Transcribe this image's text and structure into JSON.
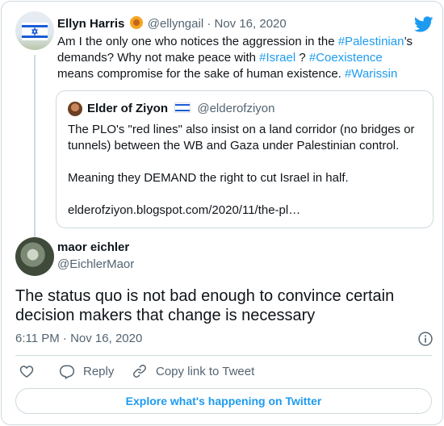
{
  "parent_tweet": {
    "name": "Ellyn Harris",
    "handle": "@ellyngail",
    "separator": "·",
    "date": "Nov 16, 2020",
    "text_parts": [
      "Am I the only one who notices the aggression in the ",
      "#Palestinian",
      "’s demands? Why not make peace with ",
      "#Israel",
      " ? ",
      "#Coexistence",
      " means compromise for the sake of human existence. ",
      "#Warissin"
    ]
  },
  "quoted_tweet": {
    "name": "Elder of Ziyon",
    "handle": "@elderofziyon",
    "paragraphs": [
      "The PLO's \"red lines\" also insist on a land corridor (no bridges or tunnels) between the WB and Gaza under Palestinian control.",
      "Meaning they DEMAND the right to cut Israel in half.",
      "elderofziyon.blogspot.com/2020/11/the-pl…"
    ]
  },
  "reply_tweet": {
    "name": "maor eichler",
    "handle": "@EichlerMaor",
    "text": "The status quo is not bad enough to convince certain decision makers that change is necessary",
    "time": "6:11 PM",
    "separator": "·",
    "date": "Nov 16, 2020"
  },
  "actions": {
    "reply_label": "Reply",
    "copy_link_label": "Copy link to Tweet"
  },
  "explore_label": "Explore what's happening on Twitter",
  "colors": {
    "accent": "#1d9bf0",
    "text": "#0f1419",
    "muted": "#536471",
    "border": "#cfd9de"
  },
  "icons": [
    "twitter-bird-icon",
    "info-icon",
    "heart-icon",
    "reply-icon",
    "link-icon"
  ]
}
